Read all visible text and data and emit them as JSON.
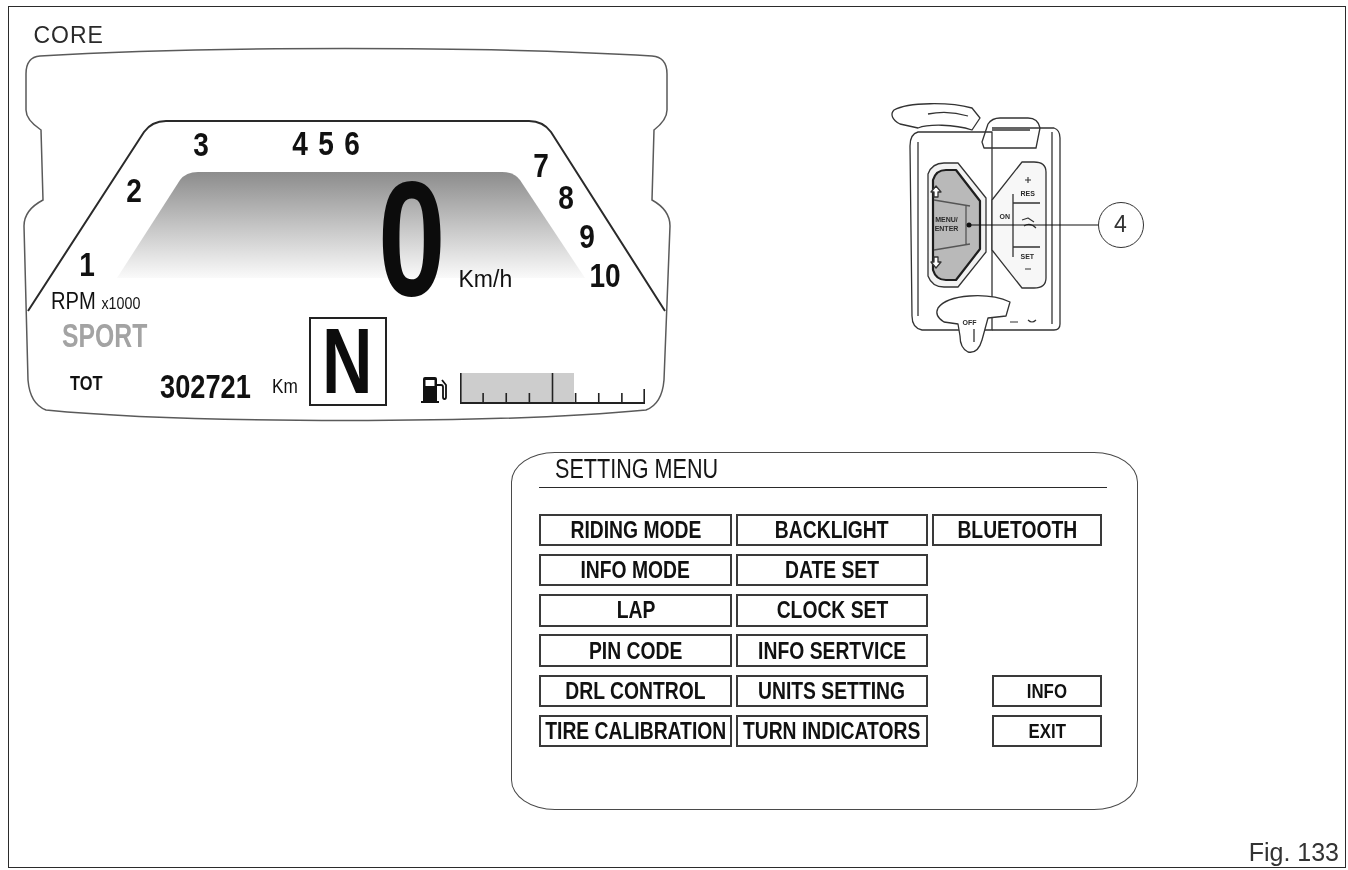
{
  "instrument_display": {
    "title": "CORE",
    "rpm_scale": [
      "1",
      "2",
      "3",
      "4",
      "5",
      "6",
      "7",
      "8",
      "9",
      "10"
    ],
    "rpm_unit": "RPM",
    "rpm_multiplier": "x1000",
    "speed": "0",
    "speed_unit": "Km/h",
    "riding_mode": "SPORT",
    "odometer": {
      "label": "TOT",
      "value": "302721",
      "unit": "Km"
    },
    "gear": "N",
    "fuel_gauge": {
      "level": 0.62
    }
  },
  "handlebar_switch": {
    "button_labels": [
      "MENU/ ENTER",
      "ON",
      "RES",
      "SET",
      "OFF"
    ],
    "callout": "4"
  },
  "setting_menu": {
    "title": "SETTING MENU",
    "rows": [
      [
        "RIDING MODE",
        "BACKLIGHT",
        "BLUETOOTH"
      ],
      [
        "INFO MODE",
        "DATE SET"
      ],
      [
        "LAP",
        "CLOCK SET"
      ],
      [
        "PIN CODE",
        "INFO SERTVICE"
      ],
      [
        "DRL CONTROL",
        "UNITS SETTING"
      ],
      [
        "TIRE CALIBRATION",
        "TURN INDICATORS"
      ]
    ],
    "buttons": [
      "INFO",
      "EXIT"
    ]
  },
  "caption": "Fig. 133"
}
